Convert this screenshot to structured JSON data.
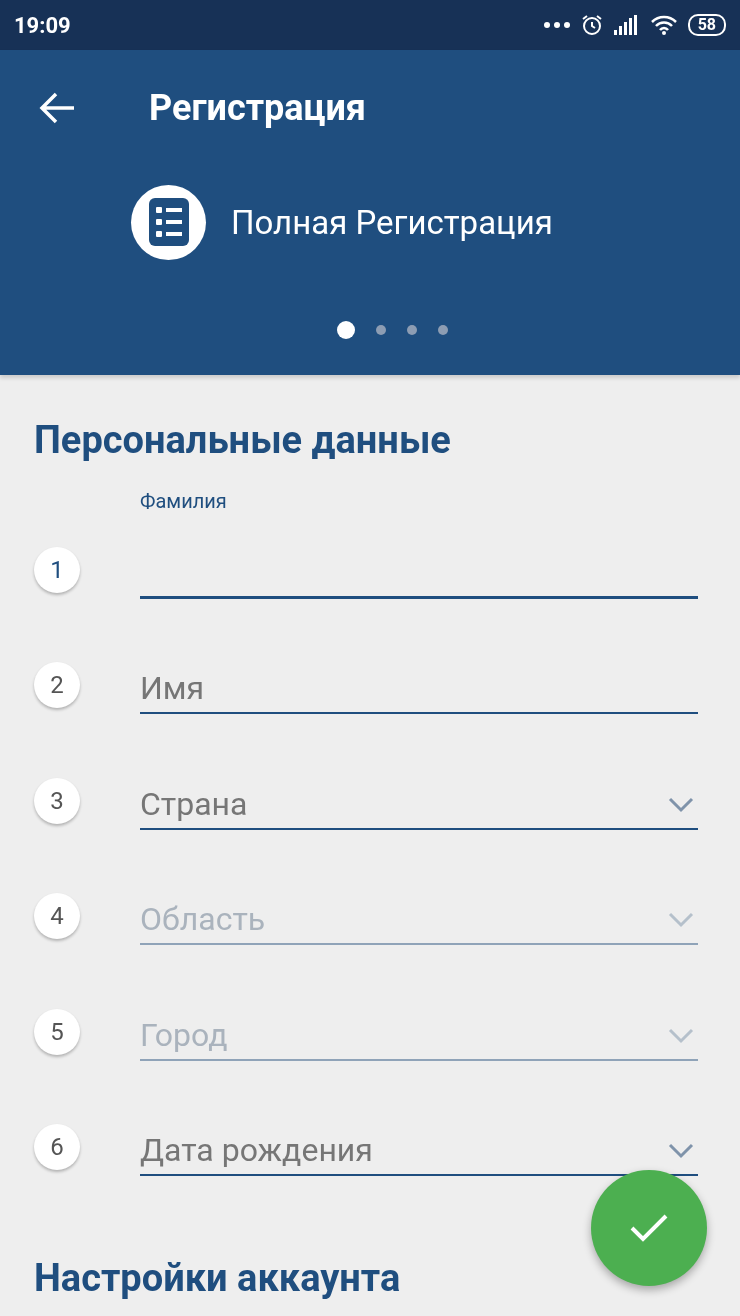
{
  "status_bar": {
    "time": "19:09",
    "battery": "58"
  },
  "app_bar": {
    "title": "Регистрация"
  },
  "header": {
    "subtitle": "Полная Регистрация",
    "pages": [
      {
        "selected": true
      },
      {
        "selected": false
      },
      {
        "selected": false
      },
      {
        "selected": false
      }
    ]
  },
  "sections": [
    {
      "title": "Персональные данные",
      "fields": [
        {
          "number": "1",
          "kind": "text",
          "label": "Фамилия",
          "focused": true,
          "disabled": false
        },
        {
          "number": "2",
          "kind": "text",
          "placeholder": "Имя",
          "focused": false,
          "disabled": false
        },
        {
          "number": "3",
          "kind": "select",
          "placeholder": "Страна",
          "focused": false,
          "disabled": false
        },
        {
          "number": "4",
          "kind": "select",
          "placeholder": "Область",
          "focused": false,
          "disabled": true
        },
        {
          "number": "5",
          "kind": "select",
          "placeholder": "Город",
          "focused": false,
          "disabled": true
        },
        {
          "number": "6",
          "kind": "select",
          "placeholder": "Дата рождения",
          "focused": false,
          "disabled": false
        }
      ]
    },
    {
      "title": "Настройки аккаунта"
    }
  ]
}
